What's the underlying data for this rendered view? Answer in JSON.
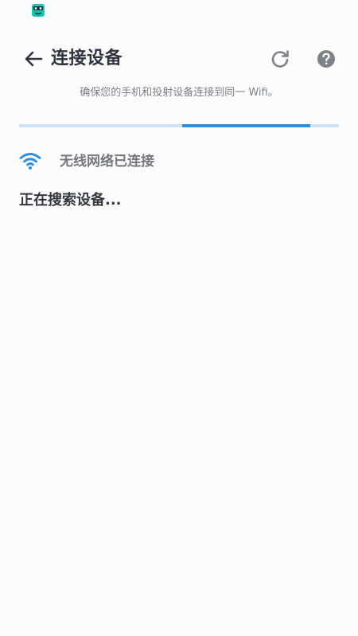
{
  "header": {
    "title": "连接设备"
  },
  "subtitle": "确保您的手机和投射设备连接到同一 Wifi。",
  "progress": {
    "fill_fraction_start": 0.51,
    "fill_fraction_end": 0.91
  },
  "wifi": {
    "status": "无线网络已连接"
  },
  "search": {
    "status": "正在搜索设备..."
  },
  "colors": {
    "accent": "#2b8fe3",
    "progress_track": "#cfe3f6",
    "title": "#2f3440",
    "subtitle": "#7c8088",
    "app_icon": "#1cc6b6"
  },
  "icons": {
    "status_app": "app-mascot-icon",
    "back": "arrow-left-icon",
    "refresh": "refresh-icon",
    "help": "question-circle-icon",
    "wifi": "wifi-icon"
  }
}
